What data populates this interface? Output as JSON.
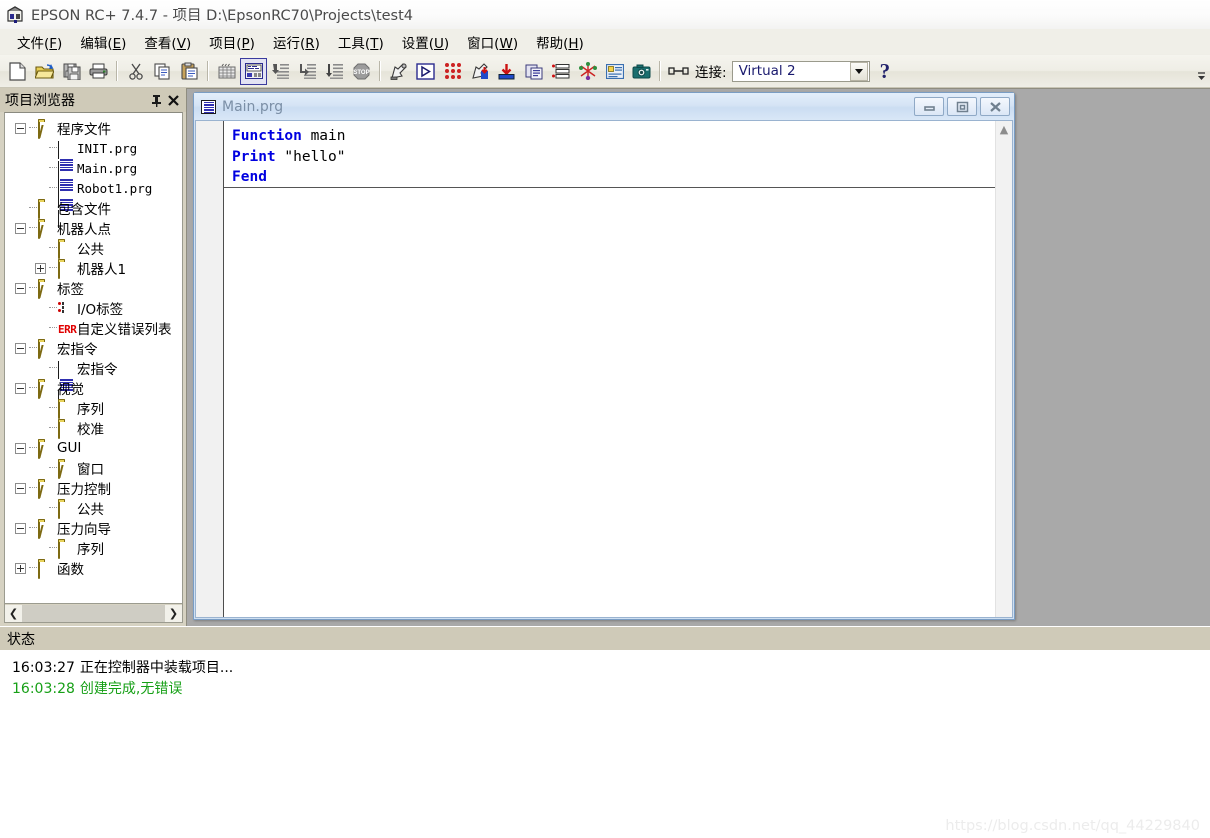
{
  "window": {
    "title": "EPSON RC+ 7.4.7 - 项目 D:\\EpsonRC70\\Projects\\test4",
    "app_icon": "epson-rc-icon"
  },
  "menu": [
    {
      "label": "文件",
      "mnemonic": "F"
    },
    {
      "label": "编辑",
      "mnemonic": "E"
    },
    {
      "label": "查看",
      "mnemonic": "V"
    },
    {
      "label": "项目",
      "mnemonic": "P"
    },
    {
      "label": "运行",
      "mnemonic": "R"
    },
    {
      "label": "工具",
      "mnemonic": "T"
    },
    {
      "label": "设置",
      "mnemonic": "U"
    },
    {
      "label": "窗口",
      "mnemonic": "W"
    },
    {
      "label": "帮助",
      "mnemonic": "H"
    }
  ],
  "toolbar": {
    "buttons": [
      {
        "icon": "new-file-icon"
      },
      {
        "icon": "open-folder-icon"
      },
      {
        "icon": "save-all-icon"
      },
      {
        "icon": "print-icon"
      },
      {
        "sep": true
      },
      {
        "icon": "cut-icon"
      },
      {
        "icon": "copy-icon"
      },
      {
        "icon": "paste-icon"
      },
      {
        "sep": true
      },
      {
        "icon": "build-project-icon"
      },
      {
        "icon": "command-window-icon",
        "pressed": true
      },
      {
        "icon": "step-into-icon"
      },
      {
        "icon": "step-over-icon"
      },
      {
        "icon": "run-to-line-icon"
      },
      {
        "icon": "stop-icon"
      },
      {
        "sep": true
      },
      {
        "icon": "robot-manager-icon"
      },
      {
        "icon": "run-window-icon"
      },
      {
        "icon": "io-monitor-icon"
      },
      {
        "icon": "robot-jog-icon"
      },
      {
        "icon": "force-monitor-icon"
      },
      {
        "icon": "task-manager-icon"
      },
      {
        "icon": "io-panel-icon"
      },
      {
        "icon": "vision-tool-icon"
      },
      {
        "icon": "simulator-icon"
      },
      {
        "icon": "camera-icon"
      },
      {
        "sep": true
      }
    ],
    "connect_icon": "connection-icon",
    "connect_label": "连接:",
    "connection_value": "Virtual 2",
    "dropdown_icon": "chevron-down-icon",
    "help_label": "?",
    "overflow_icon": "toolbar-overflow-icon"
  },
  "explorer": {
    "title": "项目浏览器",
    "pin_icon": "pin-icon",
    "close_icon": "close-icon",
    "scroll_left_icon": "scroll-left-arrow",
    "scroll_right_icon": "scroll-right-arrow",
    "tree": [
      {
        "label": "程序文件",
        "depth": 0,
        "twisty": "minus",
        "icon": "folder-open-icon"
      },
      {
        "label": "INIT.prg",
        "depth": 1,
        "twisty": "none",
        "icon": "program-file-icon",
        "mono": true
      },
      {
        "label": "Main.prg",
        "depth": 1,
        "twisty": "none",
        "icon": "program-file-icon",
        "mono": true
      },
      {
        "label": "Robot1.prg",
        "depth": 1,
        "twisty": "none",
        "icon": "program-file-icon",
        "mono": true
      },
      {
        "label": "包含文件",
        "depth": 0,
        "twisty": "none",
        "icon": "folder-icon"
      },
      {
        "label": "机器人点",
        "depth": 0,
        "twisty": "minus",
        "icon": "folder-open-icon"
      },
      {
        "label": "公共",
        "depth": 1,
        "twisty": "none",
        "icon": "folder-icon"
      },
      {
        "label": "机器人1",
        "depth": 1,
        "twisty": "plus",
        "icon": "folder-icon"
      },
      {
        "label": "标签",
        "depth": 0,
        "twisty": "minus",
        "icon": "folder-open-icon"
      },
      {
        "label": "I/O标签",
        "depth": 1,
        "twisty": "none",
        "icon": "io-label-icon"
      },
      {
        "label": "自定义错误列表",
        "depth": 1,
        "twisty": "none",
        "icon": "error-list-icon"
      },
      {
        "label": "宏指令",
        "depth": 0,
        "twisty": "minus",
        "icon": "folder-open-icon"
      },
      {
        "label": "宏指令",
        "depth": 1,
        "twisty": "none",
        "icon": "program-file-icon"
      },
      {
        "label": "视觉",
        "depth": 0,
        "twisty": "minus",
        "icon": "folder-open-icon"
      },
      {
        "label": "序列",
        "depth": 1,
        "twisty": "none",
        "icon": "folder-icon"
      },
      {
        "label": "校准",
        "depth": 1,
        "twisty": "none",
        "icon": "folder-icon"
      },
      {
        "label": "GUI",
        "depth": 0,
        "twisty": "minus",
        "icon": "folder-open-icon"
      },
      {
        "label": "窗口",
        "depth": 1,
        "twisty": "none",
        "icon": "folder-open-icon"
      },
      {
        "label": "压力控制",
        "depth": 0,
        "twisty": "minus",
        "icon": "folder-open-icon"
      },
      {
        "label": "公共",
        "depth": 1,
        "twisty": "none",
        "icon": "folder-icon"
      },
      {
        "label": "压力向导",
        "depth": 0,
        "twisty": "minus",
        "icon": "folder-open-icon"
      },
      {
        "label": "序列",
        "depth": 1,
        "twisty": "none",
        "icon": "folder-icon"
      },
      {
        "label": "函数",
        "depth": 0,
        "twisty": "plus",
        "icon": "folder-icon"
      }
    ]
  },
  "editor_window": {
    "icon": "program-file-icon",
    "title": "Main.prg",
    "minimize_icon": "minimize-icon",
    "maximize_icon": "restore-icon",
    "close_icon": "close-icon",
    "scroll_up_icon": "scroll-up-arrow",
    "code_lines": [
      {
        "kw": "Function",
        "rest": " main"
      },
      {
        "kw": "Print",
        "rest": " \"hello\""
      },
      {
        "kw": "Fend",
        "rest": ""
      }
    ]
  },
  "status": {
    "title": "状态",
    "lines": [
      {
        "time": "16:03:27",
        "text": "正在控制器中装载项目...",
        "color": "#000000"
      },
      {
        "time": "16:03:28",
        "text": "创建完成,无错误",
        "color": "#17a017"
      }
    ]
  },
  "watermark": "https://blog.csdn.net/qq_44229840",
  "colors": {
    "chrome": "#d6d2c2",
    "panel_header": "#cfcab8",
    "mdi_background": "#a9a9a9",
    "child_window": "#cfe0f2",
    "keyword_blue": "#0000d0",
    "success_green": "#17a017"
  }
}
